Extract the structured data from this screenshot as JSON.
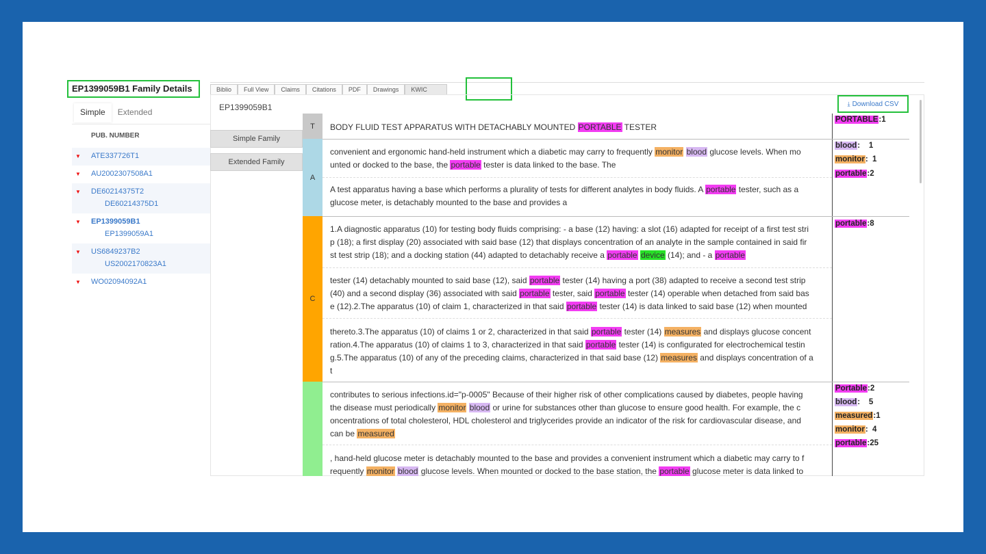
{
  "family": {
    "title": "EP1399059B1 Family Details",
    "tabs": [
      {
        "label": "Simple",
        "active": true
      },
      {
        "label": "Extended",
        "active": false
      }
    ],
    "pub_header": "PUB. NUMBER",
    "rows": [
      {
        "main": "ATE337726T1",
        "subs": [],
        "bold": false,
        "alt": true
      },
      {
        "main": "AU2002307508A1",
        "subs": [],
        "bold": false,
        "alt": false
      },
      {
        "main": "DE60214375T2",
        "subs": [
          "DE60214375D1"
        ],
        "bold": false,
        "alt": true
      },
      {
        "main": "EP1399059B1",
        "subs": [
          "EP1399059A1"
        ],
        "bold": true,
        "alt": false
      },
      {
        "main": "US6849237B2",
        "subs": [
          "US2002170823A1"
        ],
        "bold": false,
        "alt": true
      },
      {
        "main": "WO02094092A1",
        "subs": [],
        "bold": false,
        "alt": false
      }
    ]
  },
  "tabs": [
    "Biblio",
    "Full View",
    "Claims",
    "Citations",
    "PDF",
    "Drawings",
    "KWIC"
  ],
  "active_tab": "KWIC",
  "pub_id": "EP1399059B1",
  "family_buttons": {
    "simple": "Simple Family",
    "extended": "Extended Family"
  },
  "download_label": "Download CSV",
  "download_icon": "download-icon",
  "colors": {
    "portable": "#f23cf2",
    "monitor": "#f4b163",
    "blood": "#d7b8f2",
    "measures": "#f4b163",
    "device": "#27e027",
    "T": "#c8c8c8",
    "A": "#add8e6",
    "C": "#ffa500",
    "D": "#90ee90"
  },
  "sections": [
    {
      "id": "T",
      "label": "T",
      "snippets": [
        "BODY FLUID TEST APPARATUS WITH DETACHABLY MOUNTED [[portable:PORTABLE]] TESTER"
      ],
      "keywords": [
        {
          "term": "PORTABLE",
          "sep": ":",
          "count": "1",
          "class": "portable"
        }
      ]
    },
    {
      "id": "A",
      "label": "A",
      "snippets": [
        "convenient and ergonomic hand-held instrument which a diabetic may carry to frequently [[monitor:monitor]] [[blood:blood]] glucose levels. When mo|unted or docked to the base, the [[portable:portable]] tester is data linked to the base. The",
        "A test apparatus having a base which performs a plurality of tests for different analytes in body fluids. A [[portable:portable]] tester, such as a|glucose meter, is detachably mounted to the base and provides a"
      ],
      "keywords": [
        {
          "term": "blood",
          "sep": ":",
          "count": "1",
          "class": "blood"
        },
        {
          "term": "monitor",
          "sep": ":",
          "count": "1",
          "class": "monitor"
        },
        {
          "term": "portable",
          "sep": ":",
          "count": "2",
          "class": "portable"
        }
      ]
    },
    {
      "id": "C",
      "label": "C",
      "snippets": [
        "1.A diagnostic apparatus (10) for testing body fluids comprising: - a base (12) having: a slot (16) adapted for receipt of a first test stri|p (18); a first display (20) associated with said base (12) that displays concentration of an analyte in the sample contained in said fir|st test strip (18); and a docking station (44) adapted to detachably receive a [[portable:portable]] [[device:device]] (14); and - a [[portable:portable]]",
        "tester (14) detachably mounted to said base (12), said [[portable:portable]] tester (14) having a port (38) adapted to receive a second test strip|(40) and a second display (36) associated with said [[portable:portable]] tester, said [[portable:portable]] tester (14) operable when detached from said bas|e (12).2.The apparatus (10) of claim 1, characterized in that said [[portable:portable]] tester (14) is data linked to said base (12) when mounted",
        "thereto.3.The apparatus (10) of claims 1 or 2, characterized in that said [[portable:portable]] tester (14) [[measures:measures]] and displays glucose concent|ration.4.The apparatus (10) of claims 1 to 3, characterized in that said [[portable:portable]] tester (14) is configurated for electrochemical testin|g.5.The apparatus (10) of any of the preceding claims, characterized in that said base (12) [[measures:measures]] and displays concentration of a|t"
      ],
      "keywords": [
        {
          "term": "portable",
          "sep": ":",
          "count": "8",
          "class": "portable"
        }
      ]
    },
    {
      "id": "D",
      "label": "",
      "snippets": [
        "contributes to serious infections.id=\"p-0005\" Because of their higher risk of other complications caused by diabetes, people having|the disease must periodically [[monitor:monitor]] [[blood:blood]] or urine for substances other than glucose to ensure good health. For example, the c|oncentrations of total cholesterol, HDL cholesterol and triglycerides provide an indicator of the risk for cardiovascular disease, and|can be [[measures:measured]]",
        ", hand-held glucose meter is detachably mounted to the base and provides a convenient instrument which a diabetic may carry to f|requently [[monitor:monitor]] [[blood:blood]] glucose levels. When mounted or docked to the base station, the [[portable:portable]] glucose meter is data linked to"
      ],
      "keywords": [
        {
          "term": "Portable",
          "sep": ":",
          "count": "2",
          "class": "portable"
        },
        {
          "term": "blood",
          "sep": ":",
          "count": "5",
          "class": "blood"
        },
        {
          "term": "measured",
          "sep": ":",
          "count": "1",
          "class": "measured"
        },
        {
          "term": "monitor",
          "sep": ":",
          "count": "4",
          "class": "monitor"
        },
        {
          "term": "portable",
          "sep": ":",
          "count": "25",
          "class": "portable"
        }
      ]
    }
  ]
}
